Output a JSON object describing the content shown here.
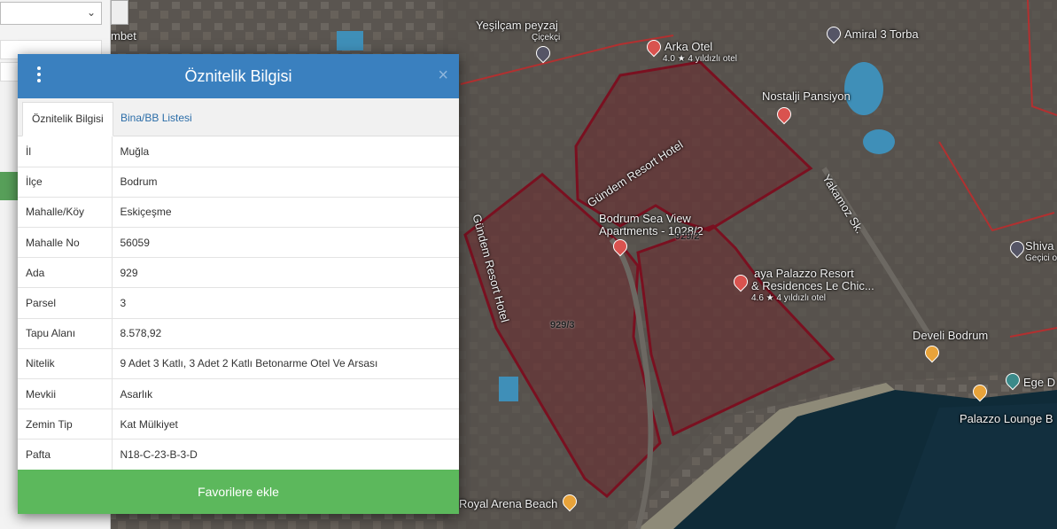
{
  "modal": {
    "title": "Öznitelik Bilgisi",
    "close_symbol": "×",
    "menu_icon": "kebab-vertical-icon",
    "tabs": [
      {
        "label": "Öznitelik Bilgisi",
        "active": true
      },
      {
        "label": "Bina/BB Listesi",
        "active": false
      }
    ],
    "rows": [
      {
        "key": "İl",
        "value": "Muğla"
      },
      {
        "key": "İlçe",
        "value": "Bodrum"
      },
      {
        "key": "Mahalle/Köy",
        "value": "Eskiçeşme"
      },
      {
        "key": "Mahalle No",
        "value": "56059"
      },
      {
        "key": "Ada",
        "value": "929"
      },
      {
        "key": "Parsel",
        "value": "3"
      },
      {
        "key": "Tapu Alanı",
        "value": "8.578,92"
      },
      {
        "key": "Nitelik",
        "value": "9 Adet 3 Katlı, 3 Adet 2 Katlı Betonarme Otel Ve Arsası"
      },
      {
        "key": "Mevkii",
        "value": "Asarlık"
      },
      {
        "key": "Zemin Tip",
        "value": "Kat Mülkiyet"
      },
      {
        "key": "Pafta",
        "value": "N18-C-23-B-3-D"
      }
    ],
    "favorite_button": "Favorilere ekle"
  },
  "map": {
    "labels": {
      "yesilcam": "Yeşilçam peyzaj",
      "cicekci": "Çiçekçi",
      "mbet": "mbet",
      "arka_otel": "Arka Otel",
      "arka_otel_sub": "4.0 ★ 4 yıldızlı otel",
      "amiral": "Amiral 3 Torba",
      "nostalji": "Nostalji Pansiyon",
      "gundem_1": "Gündem Resort Hotel",
      "gundem_2": "Gündem Resort Hotel",
      "bodrum_sea_view": "Bodrum Sea View",
      "apartments": "Apartments - 1028/2",
      "parcel_929_2": "929/2",
      "yakamoz": "Yakamoz Sk.",
      "shiva": "Shiva",
      "shiva_sub": "Geçici ol",
      "palazzo": "aya Palazzo Resort",
      "palazzo_2": "& Residences Le Chic...",
      "palazzo_sub": "4.6 ★ 4 yıldızlı otel",
      "parcel_929_3": "929/3",
      "develi": "Develi Bodrum",
      "ege": "Ege D",
      "palazzo_lounge": "Palazzo Lounge B",
      "royal_arena": "Royal Arena Beach"
    },
    "colors": {
      "header_blue": "#3a80bf",
      "favorite_green": "#5cb85c",
      "parcel_outline": "#7a1020",
      "parcel_fill": "rgba(120,20,30,0.35)"
    }
  }
}
